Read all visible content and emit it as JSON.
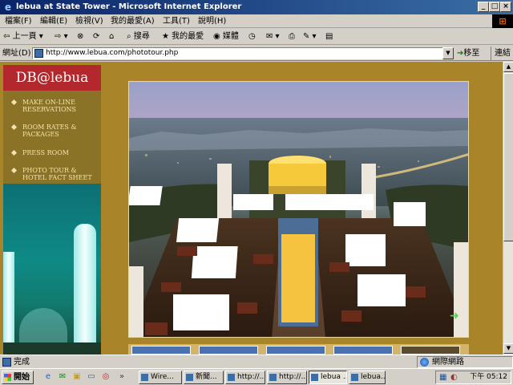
{
  "window": {
    "title": "lebua at State Tower - Microsoft Internet Explorer",
    "controls": [
      "_",
      "□",
      "×"
    ]
  },
  "menu": [
    "檔案(F)",
    "編輯(E)",
    "檢視(V)",
    "我的最愛(A)",
    "工具(T)",
    "說明(H)"
  ],
  "toolbar": {
    "back": "上一頁",
    "search": "搜尋",
    "favorites": "我的最愛",
    "media": "媒體"
  },
  "address": {
    "label": "網址(D)",
    "url": "http://www.lebua.com/phototour.php",
    "go": "移至",
    "links": "連結"
  },
  "site": {
    "logo": "DB@lebua",
    "nav": [
      {
        "label": "MAKE ON-LINE RESERVATIONS"
      },
      {
        "label": "ROOM RATES & PACKAGES"
      },
      {
        "label": "PRESS ROOM"
      },
      {
        "label": "PHOTO TOUR & HOTEL FACT SHEET"
      }
    ]
  },
  "status": {
    "text": "完成",
    "zone": "網際網路"
  },
  "taskbar": {
    "start": "開始",
    "quicklaunch": [
      "ie-icon",
      "outlook-icon",
      "folder-icon",
      "desktop-icon",
      "media-icon"
    ],
    "tasks": [
      "Wire...",
      "新聞...",
      "http://...",
      "http://...",
      "lebua ...",
      "lebua..."
    ],
    "clock": "下午 05:12"
  }
}
